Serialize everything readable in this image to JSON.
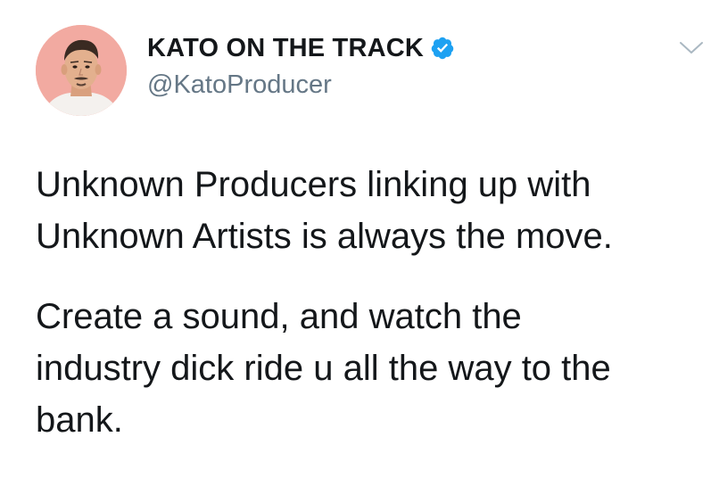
{
  "tweet": {
    "display_name": "KATO ON THE TRACK",
    "handle": "@KatoProducer",
    "paragraphs": [
      [
        "Unknown Producers linking up with",
        "Unknown Artists is always the move."
      ],
      [
        "Create a sound, and watch the",
        "industry dick ride u all the way to the",
        "bank."
      ]
    ]
  },
  "icons": {
    "verified": "verified-badge-icon",
    "menu": "chevron-down-icon"
  },
  "colors": {
    "text": "#14171a",
    "handle": "#657786",
    "verified_blue": "#1da1f2",
    "avatar_bg": "#f2aaa1"
  }
}
